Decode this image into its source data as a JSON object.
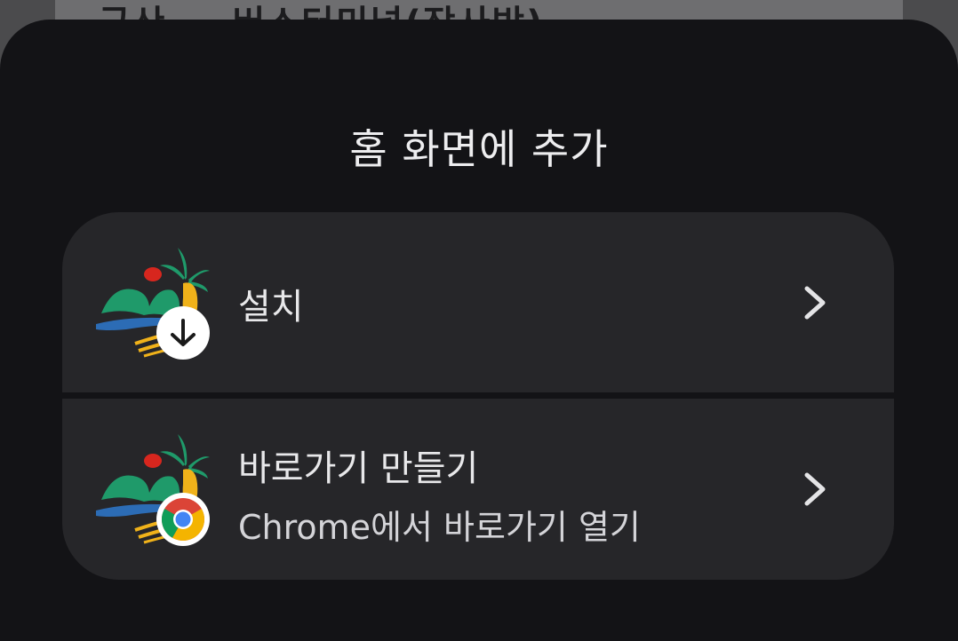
{
  "background_page": {
    "partial_title": "군산 … 버스터미널(장사방)"
  },
  "sheet": {
    "title": "홈 화면에 추가",
    "install": {
      "label": "설치",
      "badge_icon": "download-arrow-icon",
      "chevron_icon": "chevron-right-icon"
    },
    "shortcut": {
      "label": "바로가기 만들기",
      "sublabel": "Chrome에서 바로가기 열기",
      "badge_icon": "chrome-icon",
      "chevron_icon": "chevron-right-icon"
    }
  },
  "colors": {
    "sheet_bg": "#131316",
    "card_bg": "#262629",
    "text_primary": "#ededef",
    "logo_green": "#1f9a6a",
    "logo_red": "#d7261e",
    "logo_blue": "#2c6cb5",
    "logo_yellow": "#f0b21a"
  }
}
